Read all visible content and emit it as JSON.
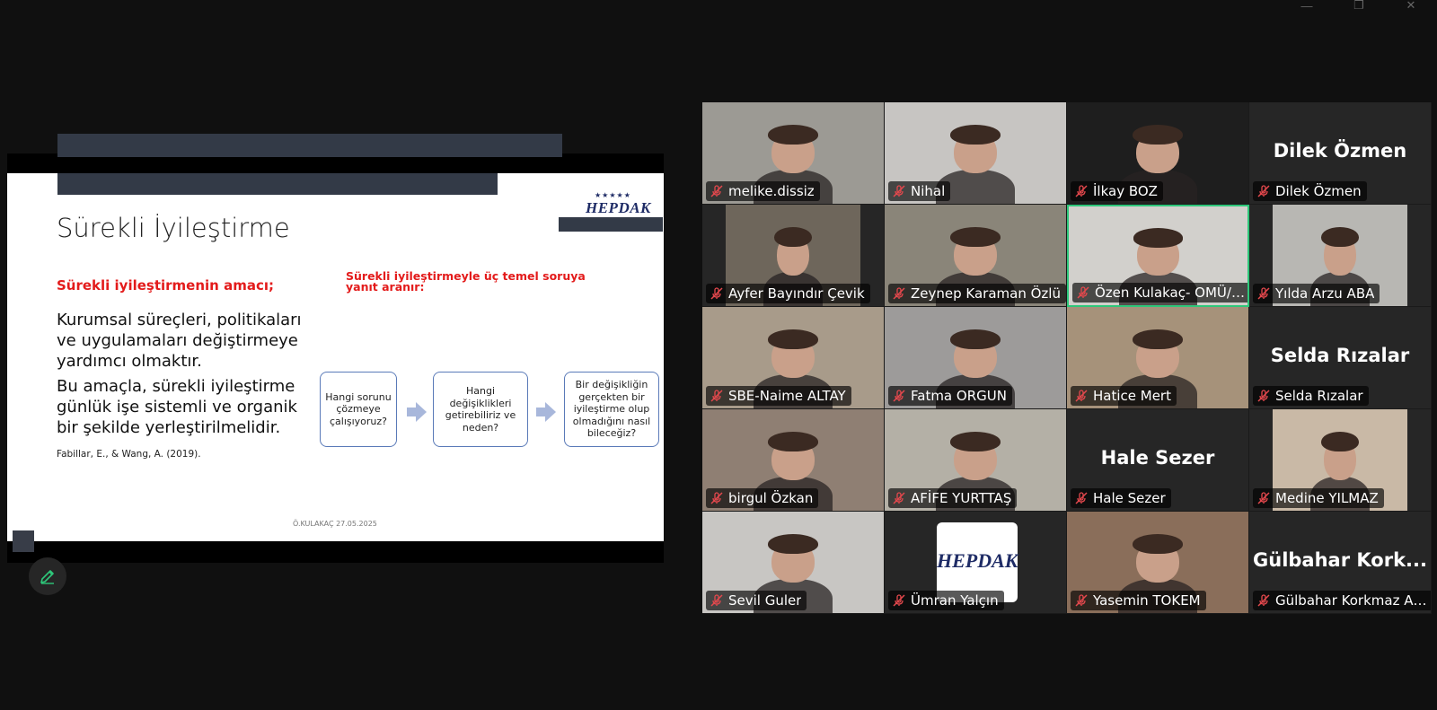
{
  "window": {
    "minimize": "—",
    "restore": "❐",
    "close": "✕"
  },
  "slide": {
    "logo_stars": "★★★★★",
    "logo_text": "HEPDAK",
    "title": "Sürekli İyileştirme",
    "left_heading": "Sürekli iyileştirmenin amacı;",
    "right_heading": "Sürekli iyileştirmeyle üç temel soruya yanıt aranır:",
    "para1": "Kurumsal süreçleri, politikaları ve uygulamaları değiştirmeye yardımcı olmaktır.",
    "para2": "Bu amaçla, sürekli iyileştirme günlük işe sistemli ve organik bir şekilde yerleştirilmelidir.",
    "citation": "Fabillar, E., & Wang, A. (2019).",
    "questions": [
      "Hangi sorunu çözmeye çalışıyoruz?",
      "Hangi değişiklikleri getirebiliriz ve neden?",
      "Bir değişikliğin gerçekten bir iyileştirme olup olmadığını nasıl bileceğiz?"
    ],
    "footer": "Ö.KULAKAÇ 27.05.2025"
  },
  "participants": [
    {
      "name": "melike.dissiz",
      "video": true,
      "bg": "#9c9a94"
    },
    {
      "name": "Nihal",
      "video": true,
      "bg": "#c7c5c2"
    },
    {
      "name": "İlkay BOZ",
      "video": true,
      "bg": "#1e1e1e"
    },
    {
      "name": "Dilek Özmen",
      "video": false,
      "display": "Dilek Özmen"
    },
    {
      "name": "Ayfer Bayındır Çevik",
      "video": true,
      "bg": "#6e665b"
    },
    {
      "name": "Zeynep Karaman Özlü",
      "video": true,
      "bg": "#8a8579"
    },
    {
      "name": "Özen Kulakaç- OMÜ/HEP...",
      "video": true,
      "bg": "#d2d0cc",
      "active": true
    },
    {
      "name": "Yılda Arzu ABA",
      "video": true,
      "bg": "#b8b7b3"
    },
    {
      "name": "SBE-Naime ALTAY",
      "video": true,
      "bg": "#a89b8a"
    },
    {
      "name": "Fatma ORGUN",
      "video": true,
      "bg": "#9d9b9a"
    },
    {
      "name": "Hatice Mert",
      "video": true,
      "bg": "#a6927a"
    },
    {
      "name": "Selda Rızalar",
      "video": false,
      "display": "Selda Rızalar"
    },
    {
      "name": "birgul Özkan",
      "video": true,
      "bg": "#8f7f73"
    },
    {
      "name": "AFİFE YURTTAŞ",
      "video": true,
      "bg": "#b4b0a6"
    },
    {
      "name": "Hale Sezer",
      "video": false,
      "display": "Hale Sezer"
    },
    {
      "name": "Medine YILMAZ",
      "video": true,
      "bg": "#c9b9a6"
    },
    {
      "name": "Sevil Guler",
      "video": true,
      "bg": "#c8c6c3"
    },
    {
      "name": "Ümran Yalçın",
      "video": true,
      "bg": "#ffffff",
      "logo": "HEPDAK"
    },
    {
      "name": "Yasemin TOKEM",
      "video": true,
      "bg": "#8a6e5a"
    },
    {
      "name": "Gülbahar Korkmaz Asl...",
      "video": false,
      "display": "Gülbahar  Kork..."
    }
  ],
  "colors": {
    "active_speaker": "#2ec77a",
    "muted_icon": "#e5484d"
  },
  "icons": {
    "mic": "mic-muted-icon",
    "pen": "annotate-pen-icon"
  }
}
